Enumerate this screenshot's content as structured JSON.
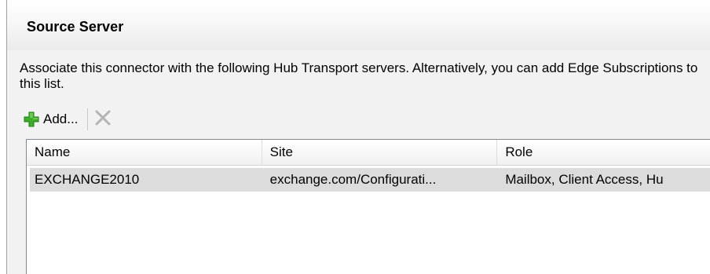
{
  "section": {
    "title": "Source Server",
    "description": "Associate this connector with the following Hub Transport servers. Alternatively, you can add Edge Subscriptions to this list."
  },
  "toolbar": {
    "add_label": "Add...",
    "add_icon": "add-plus-icon",
    "remove_icon": "remove-x-icon",
    "add_icon_color": "#3fae2a",
    "remove_icon_color": "#b4b4b4"
  },
  "list": {
    "columns": [
      "Name",
      "Site",
      "Role"
    ],
    "rows": [
      {
        "name": "EXCHANGE2010",
        "site": "exchange.com/Configurati...",
        "role": "Mailbox, Client Access, Hu",
        "selected": true
      }
    ]
  }
}
